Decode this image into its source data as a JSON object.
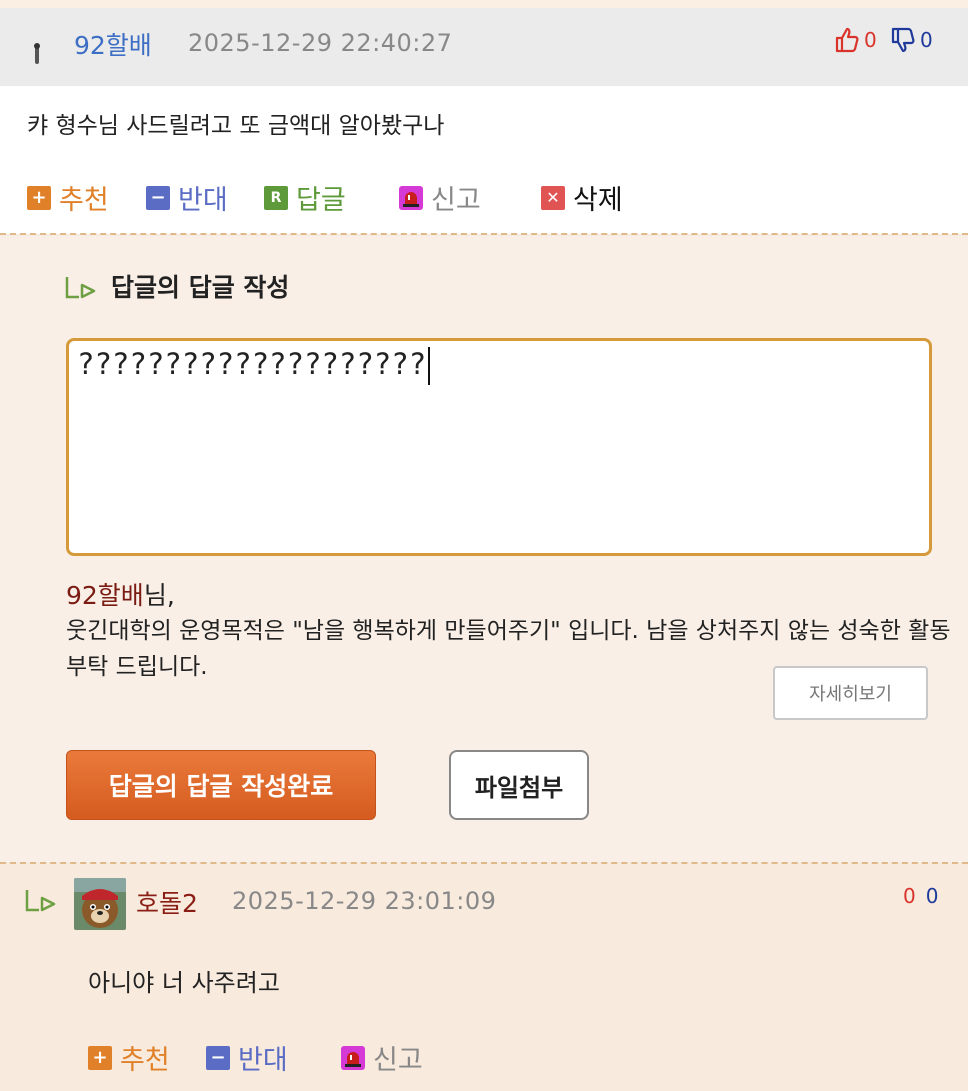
{
  "comment1": {
    "author": "92할배",
    "datetime": "2025-12-29 22:40:27",
    "upvotes": "0",
    "downvotes": "0",
    "text": "캬 형수님 사드릴려고 또 금액대 알아봤구나",
    "actions": {
      "recommend": "추천",
      "oppose": "반대",
      "reply": "답글",
      "report": "신고",
      "delete": "삭제"
    }
  },
  "reply_form": {
    "title": "답글의 답글 작성",
    "input_value": "????????????????????",
    "notice_name": "92할배",
    "notice_suffix": "님,",
    "notice_text": "웃긴대학의 운영목적은 \"남을 행복하게 만들어주기\" 입니다. 남을 상처주지 않는 성숙한 활동 부탁 드립니다.",
    "detail_button": "자세히보기",
    "submit_button": "답글의 답글 작성완료",
    "file_button": "파일첨부"
  },
  "comment2": {
    "author": "호돌2",
    "datetime": "2025-12-29 23:01:09",
    "upvotes": "0",
    "downvotes": "0",
    "text": "아니야 너 사주려고",
    "actions": {
      "recommend": "추천",
      "oppose": "반대",
      "report": "신고"
    }
  },
  "colors": {
    "recommend": "#e0812a",
    "oppose": "#5a6cc4",
    "reply": "#5e9a3a",
    "delete": "#e05454",
    "accent_border": "#d49a3c"
  },
  "icons": [
    "thumbs-up-icon",
    "thumbs-down-icon",
    "plus-icon",
    "minus-icon",
    "reply-r-icon",
    "siren-icon",
    "close-x-icon",
    "reply-arrow-icon"
  ]
}
